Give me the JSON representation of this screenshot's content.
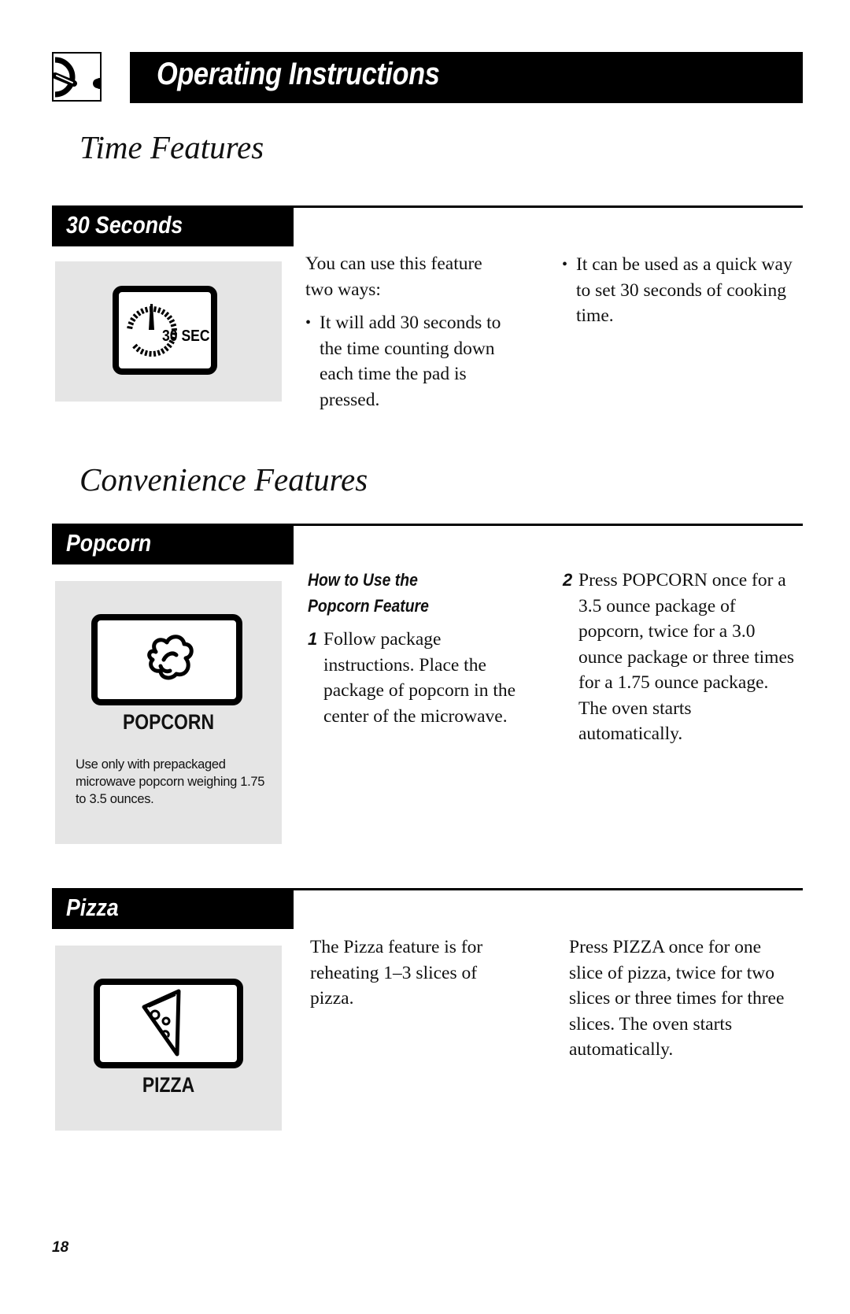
{
  "header": {
    "title": "Operating Instructions",
    "icon": "dial-knob-icon"
  },
  "sections": {
    "time": {
      "heading": "Time Features"
    },
    "convenience": {
      "heading": "Convenience Features"
    }
  },
  "thirty_seconds": {
    "bar_label": "30 Seconds",
    "pad_icon": "timer-dial-icon",
    "pad_text": "30 SEC",
    "col1_intro_line1": "You can use this feature",
    "col1_intro_line2": "two ways:",
    "col1_bullet": "It will add 30 seconds to the time counting down each time the pad is pressed.",
    "col2_bullet": "It can be used as a quick way to set 30 seconds of cooking time."
  },
  "popcorn": {
    "bar_label": "Popcorn",
    "pad_icon": "popcorn-icon",
    "pad_label": "POPCORN",
    "note": "Use only with prepackaged microwave popcorn weighing 1.75 to 3.5 ounces.",
    "subhead_line1": "How to Use the",
    "subhead_line2": "Popcorn Feature",
    "steps": [
      {
        "num": "1",
        "text": "Follow package instructions. Place the package of popcorn in the center of the microwave."
      },
      {
        "num": "2",
        "text": "Press POPCORN once for a 3.5 ounce package of popcorn, twice for a 3.0 ounce package or three times for a 1.75 ounce package. The oven starts automatically."
      }
    ]
  },
  "pizza": {
    "bar_label": "Pizza",
    "pad_icon": "pizza-slice-icon",
    "pad_label": "PIZZA",
    "col1_text": "The Pizza feature is for reheating 1–3 slices of pizza.",
    "col2_text": "Press PIZZA once for one slice of pizza, twice for two slices or three times for three slices. The oven starts automatically."
  },
  "footer": {
    "page_number": "18"
  }
}
